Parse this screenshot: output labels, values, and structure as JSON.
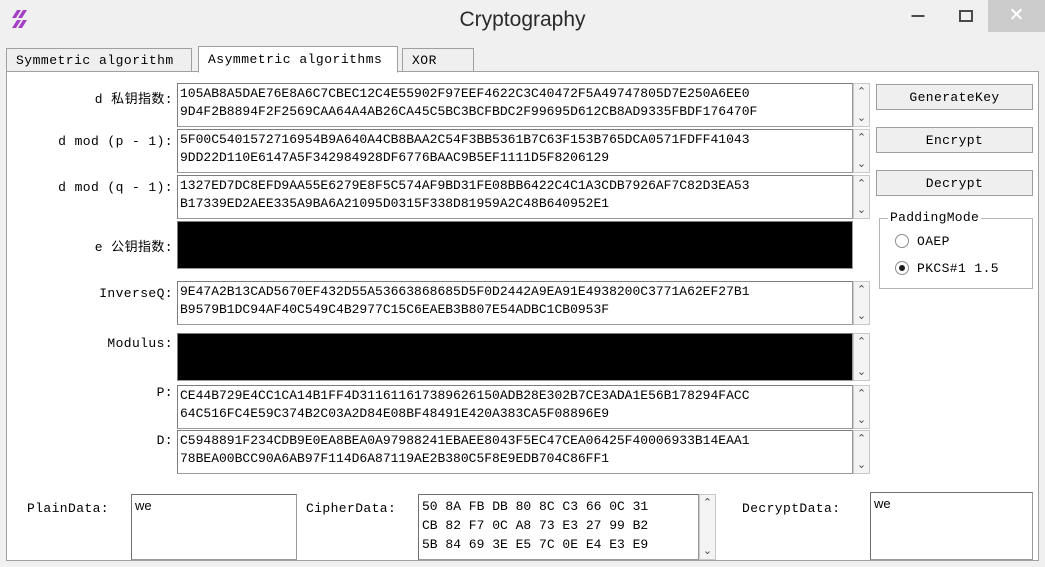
{
  "window": {
    "title": "Cryptography",
    "app_icon": "app-logo-icon",
    "minimize_label": "—",
    "maximize_label": "□",
    "close_label": "✕"
  },
  "tabs": [
    {
      "label": "Symmetric algorithm",
      "active": false
    },
    {
      "label": "Asymmetric algorithms",
      "active": true
    },
    {
      "label": "XOR",
      "active": false
    }
  ],
  "key_fields": [
    {
      "label": "d 私钥指数:",
      "masked": false,
      "lines": [
        "105AB8A5DAE76E8A6C7CBEC12C4E55902F97EEF4622C3C40472F5A49747805D7E250A6EE0",
        "9D4F2B8894F2F2569CAA64A4AB26CA45C5BC3BCFBDC2F99695D612CB8AD9335FBDF176470F"
      ]
    },
    {
      "label": "d mod (p - 1):",
      "masked": false,
      "lines": [
        "5F00C5401572716954B9A640A4CB8BAA2C54F3BB5361B7C63F153B765DCA0571FDFF41043",
        "9DD22D110E6147A5F342984928DF6776BAAC9B5EF1111D5F8206129"
      ]
    },
    {
      "label": "d mod (q - 1):",
      "masked": false,
      "lines": [
        "1327ED7DC8EFD9AA55E6279E8F5C574AF9BD31FE08BB6422C4C1A3CDB7926AF7C82D3EA53",
        "B17339ED2AEE335A9BA6A21095D0315F338D81959A2C48B640952E1"
      ]
    },
    {
      "label": "e 公钥指数:",
      "masked": true,
      "lines": [
        "",
        ""
      ]
    },
    {
      "label": "InverseQ:",
      "masked": false,
      "lines": [
        "9E47A2B13CAD5670EF432D55A53663868685D5F0D2442A9EA91E4938200C3771A62EF27B1",
        "B9579B1DC94AF40C549C4B2977C15C6EAEB3B807E54ADBC1CB0953F"
      ]
    },
    {
      "label": "Modulus:",
      "masked": true,
      "lines": [
        "",
        ""
      ]
    },
    {
      "label": "P:",
      "masked": false,
      "lines": [
        "CE44B729E4CC1CA14B1FF4D311611617389626150ADB28E302B7CE3ADA1E56B178294FACC",
        "64C516FC4E59C374B2C03A2D84E08BF48491E420A383CA5F08896E9"
      ]
    },
    {
      "label": "D:",
      "masked": false,
      "lines": [
        "C5948891F234CDB9E0EA8BEA0A97988241EBAEE8043F5EC47CEA06425F40006933B14EAA1",
        "78BEA00BCC90A6AB97F114D6A87119AE2B380C5F8E9EDB704C86FF1"
      ]
    }
  ],
  "scroll_arrows": {
    "up": "⌃",
    "down": "⌄"
  },
  "actions": {
    "generate_key": "GenerateKey",
    "encrypt": "Encrypt",
    "decrypt": "Decrypt"
  },
  "padding_mode": {
    "title": "PaddingMode",
    "options": [
      {
        "label": "OAEP",
        "selected": false
      },
      {
        "label": "PKCS#1 1.5",
        "selected": true
      }
    ]
  },
  "bottom": {
    "plain_data": {
      "label": "PlainData:",
      "value": "we"
    },
    "cipher_data": {
      "label": "CipherData:",
      "lines": [
        "50 8A FB DB 80 8C C3 66 0C 31",
        "CB 82 F7 0C A8 73 E3 27 99 B2",
        "5B 84 69 3E E5 7C 0E E4 E3 E9"
      ]
    },
    "decrypt_data": {
      "label": "DecryptData:",
      "value": "we"
    }
  }
}
